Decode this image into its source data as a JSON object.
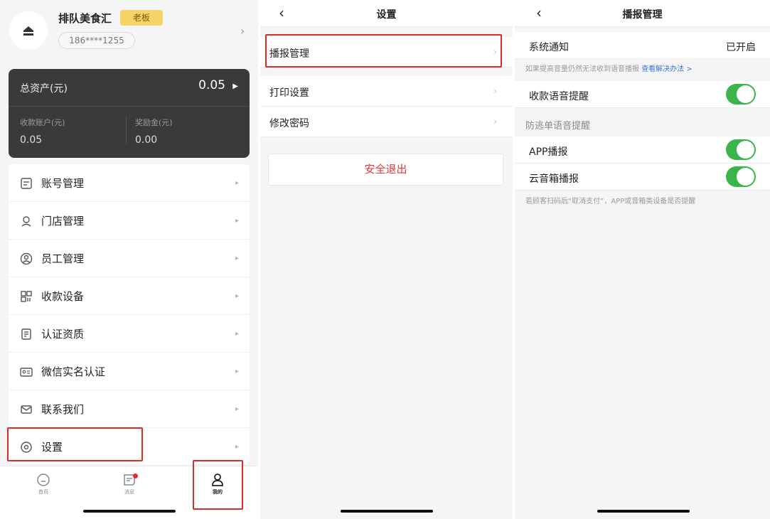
{
  "panel1": {
    "store_name": "排队美食汇",
    "role_badge": "老板",
    "phone": "186****1255",
    "assets": {
      "title": "总资产(元)",
      "total": "0.05",
      "collection_label": "收款账户(元)",
      "collection_value": "0.05",
      "bonus_label": "奖励金(元)",
      "bonus_value": "0.00"
    },
    "menu": [
      {
        "label": "账号管理",
        "icon": "account-icon"
      },
      {
        "label": "门店管理",
        "icon": "store-icon"
      },
      {
        "label": "员工管理",
        "icon": "staff-icon"
      },
      {
        "label": "收款设备",
        "icon": "device-icon"
      },
      {
        "label": "认证资质",
        "icon": "certificate-icon"
      },
      {
        "label": "微信实名认证",
        "icon": "id-card-icon"
      },
      {
        "label": "联系我们",
        "icon": "mail-icon"
      },
      {
        "label": "设置",
        "icon": "gear-icon"
      }
    ],
    "tabbar": [
      {
        "label": "首页"
      },
      {
        "label": "消息"
      },
      {
        "label": "我的"
      }
    ]
  },
  "panel2": {
    "title": "设置",
    "rows": [
      "播报管理",
      "打印设置",
      "修改密码"
    ],
    "logout": "安全退出"
  },
  "panel3": {
    "title": "播报管理",
    "system_notice_label": "系统通知",
    "system_notice_value": "已开启",
    "volume_note": "如果提高音量仍然无法收到语音播报",
    "volume_link": "查看解决办法 >",
    "payment_voice": "收款语音提醒",
    "section_title": "防逃单语音提醒",
    "app_broadcast": "APP播报",
    "cloud_speaker": "云音箱播报",
    "footer_note": "若顾客扫码后“取消支付”，APP或音箱类设备是否提醒"
  },
  "colors": {
    "highlight_box": "#e02a2a",
    "toggle_on": "#39b54a",
    "logout_text": "#e2393b",
    "link": "#3a73d9",
    "card_bg": "#3a3a3a",
    "badge_bg": "#f6d365"
  }
}
